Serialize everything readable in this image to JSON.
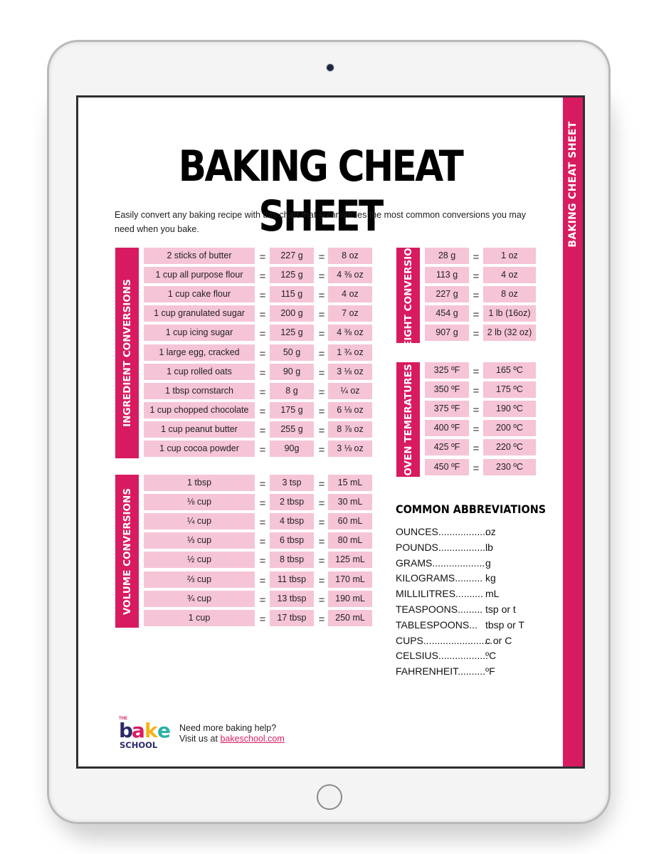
{
  "document": {
    "title": "BAKING CHEAT SHEET",
    "side_label": "BAKING CHEAT SHEET",
    "intro": "Easily convert any baking recipe with this chart that summarizes the most common conversions you may need when you bake.",
    "colors": {
      "accent": "#d81b60",
      "cell": "#f6c4d7",
      "text": "#1e1e1e"
    },
    "equals": "="
  },
  "ingredient_conversions": {
    "label": "INGREDIENT CONVERSIONS",
    "rows": [
      {
        "item": "2 sticks of butter",
        "grams": "227 g",
        "ounces": "8 oz"
      },
      {
        "item": "1 cup all purpose flour",
        "grams": "125 g",
        "ounces": "4 ⅜ oz"
      },
      {
        "item": "1 cup cake flour",
        "grams": "115 g",
        "ounces": "4 oz"
      },
      {
        "item": "1 cup granulated sugar",
        "grams": "200 g",
        "ounces": "7 oz"
      },
      {
        "item": "1 cup icing sugar",
        "grams": "125 g",
        "ounces": "4 ⅜ oz"
      },
      {
        "item": "1 large egg, cracked",
        "grams": "50 g",
        "ounces": "1 ¾ oz"
      },
      {
        "item": "1 cup rolled oats",
        "grams": "90 g",
        "ounces": "3 ⅛ oz"
      },
      {
        "item": "1 tbsp cornstarch",
        "grams": "8 g",
        "ounces": "¼ oz"
      },
      {
        "item": "1 cup chopped chocolate",
        "grams": "175 g",
        "ounces": "6 ⅛ oz"
      },
      {
        "item": "1 cup peanut butter",
        "grams": "255 g",
        "ounces": "8 ⅞ oz"
      },
      {
        "item": "1 cup cocoa powder",
        "grams": "90g",
        "ounces": "3 ⅛ oz"
      }
    ]
  },
  "volume_conversions": {
    "label": "VOLUME CONVERSIONS",
    "rows": [
      {
        "item": "1 tbsp",
        "tsp": "3 tsp",
        "ml": "15 mL"
      },
      {
        "item": "⅛ cup",
        "tsp": "2 tbsp",
        "ml": "30 mL"
      },
      {
        "item": "¼ cup",
        "tsp": "4 tbsp",
        "ml": "60 mL"
      },
      {
        "item": "⅓ cup",
        "tsp": "6 tbsp",
        "ml": "80 mL"
      },
      {
        "item": "½ cup",
        "tsp": "8 tbsp",
        "ml": "125 mL"
      },
      {
        "item": "⅔ cup",
        "tsp": "11 tbsp",
        "ml": "170 mL"
      },
      {
        "item": "¾ cup",
        "tsp": "13 tbsp",
        "ml": "190 mL"
      },
      {
        "item": "1 cup",
        "tsp": "17 tbsp",
        "ml": "250 mL"
      }
    ]
  },
  "weight_conversions": {
    "label": "WEIGHT CONVERSIONS",
    "rows": [
      {
        "grams": "28 g",
        "ounces": "1 oz"
      },
      {
        "grams": "113 g",
        "ounces": "4 oz"
      },
      {
        "grams": "227 g",
        "ounces": "8 oz"
      },
      {
        "grams": "454 g",
        "ounces": "1 lb (16oz)"
      },
      {
        "grams": "907 g",
        "ounces": "2 lb (32 oz)"
      }
    ]
  },
  "oven_temperatures": {
    "label": "OVEN TEMERATURES",
    "rows": [
      {
        "f": "325 ºF",
        "c": "165 ºC"
      },
      {
        "f": "350 ºF",
        "c": "175 ºC"
      },
      {
        "f": "375 ºF",
        "c": "190 ºC"
      },
      {
        "f": "400 ºF",
        "c": "200 ºC"
      },
      {
        "f": "425 ºF",
        "c": "220 ºC"
      },
      {
        "f": "450 ºF",
        "c": "230 ºC"
      }
    ]
  },
  "abbreviations": {
    "title": "COMMON ABBREVIATIONS",
    "items": [
      {
        "name": "OUNCES..................",
        "abbr": "oz"
      },
      {
        "name": "POUNDS..................",
        "abbr": "lb"
      },
      {
        "name": "GRAMS...................",
        "abbr": "g"
      },
      {
        "name": "KILOGRAMS..........",
        "abbr": "kg"
      },
      {
        "name": "MILLILITRES..........",
        "abbr": "mL"
      },
      {
        "name": "TEASPOONS.........",
        "abbr": "tsp or t"
      },
      {
        "name": "TABLESPOONS...",
        "abbr": "tbsp or T"
      },
      {
        "name": "CUPS.........................",
        "abbr": "c or C"
      },
      {
        "name": "CELSIUS..................",
        "abbr": "ºC"
      },
      {
        "name": "FAHRENHEIT..........",
        "abbr": "ºF"
      }
    ]
  },
  "footer": {
    "logo": {
      "the": "THE",
      "letters": [
        "b",
        "a",
        "k",
        "e"
      ],
      "letter_colors": [
        "#2a2a6a",
        "#d81b60",
        "#f5b21b",
        "#2bb3a8"
      ],
      "school": "SCHOOL"
    },
    "help_line": "Need more baking help?",
    "visit_prefix": "Visit us at ",
    "link_text": "bakeschool.com"
  }
}
